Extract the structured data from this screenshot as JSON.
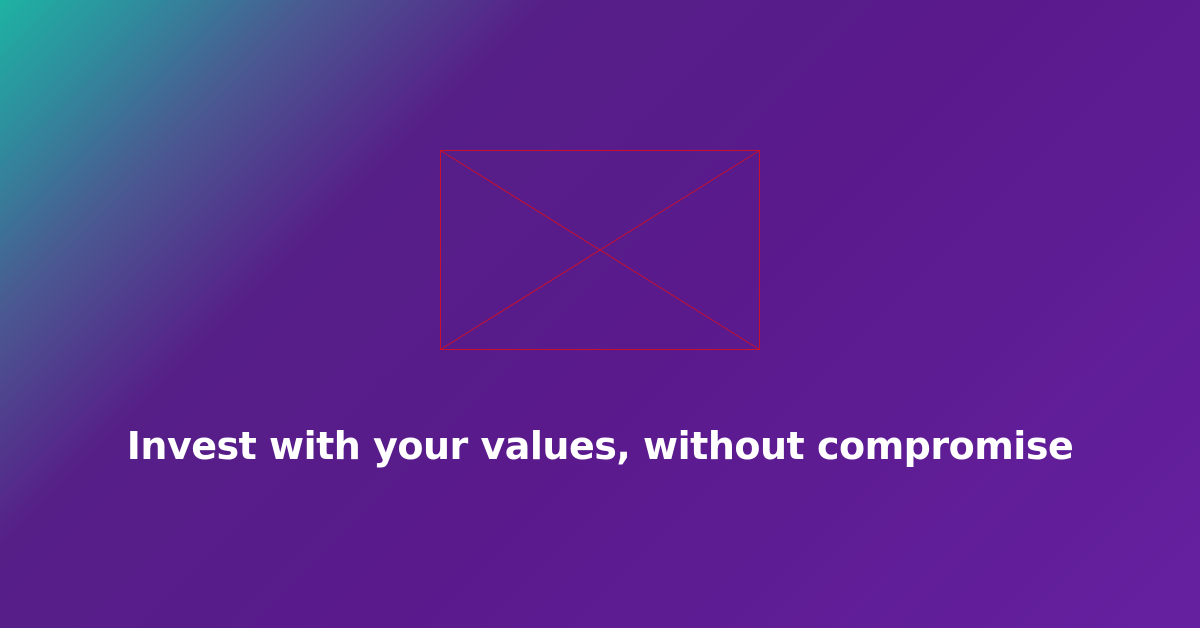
{
  "headline": "Invest with your values, without compromise",
  "image_placeholder": {
    "icon": "broken-image-placeholder",
    "stroke_color": "#c8102e"
  },
  "colors": {
    "gradient_start": "#1eb3a3",
    "gradient_mid": "#561f88",
    "gradient_end": "#6520a0",
    "text": "#ffffff"
  }
}
